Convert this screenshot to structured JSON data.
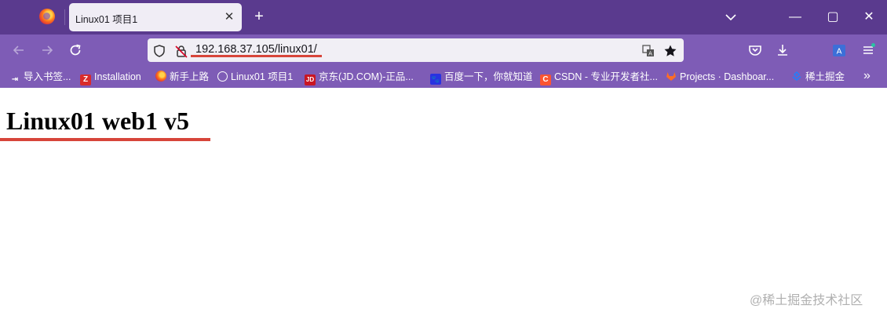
{
  "browser": {
    "tab": {
      "title": "Linux01 项目1",
      "close_glyph": "✕"
    },
    "new_tab_glyph": "+",
    "window_controls": {
      "minimize": "—",
      "maximize": "▢",
      "close": "✕"
    },
    "url": "192.168.37.105/linux01/",
    "accent_color": "#d7453a",
    "tabstrip_color": "#5a3a8e",
    "toolbar_color": "#7e5cb6"
  },
  "bookmarks": {
    "items": [
      {
        "label": "导入书签...",
        "icon": "import-icon"
      },
      {
        "label": "Installation",
        "icon": "z-icon",
        "glyph": "Z",
        "color": "#d92b2b"
      },
      {
        "label": "新手上路",
        "icon": "firefox-icon"
      },
      {
        "label": "Linux01 项目1",
        "icon": "globe-icon"
      },
      {
        "label": "京东(JD.COM)-正品...",
        "icon": "jd-icon",
        "glyph": "JD",
        "color": "#c91623"
      },
      {
        "label": "百度一下，你就知道",
        "icon": "baidu-icon"
      },
      {
        "label": "CSDN - 专业开发者社...",
        "icon": "csdn-icon",
        "glyph": "C",
        "color": "#fc5531"
      },
      {
        "label": "Projects · Dashboar...",
        "icon": "gitlab-icon"
      },
      {
        "label": "稀土掘金",
        "icon": "juejin-icon"
      }
    ],
    "more_glyph": "»"
  },
  "page": {
    "heading": "Linux01 web1 v5",
    "watermark": "@稀土掘金技术社区"
  }
}
